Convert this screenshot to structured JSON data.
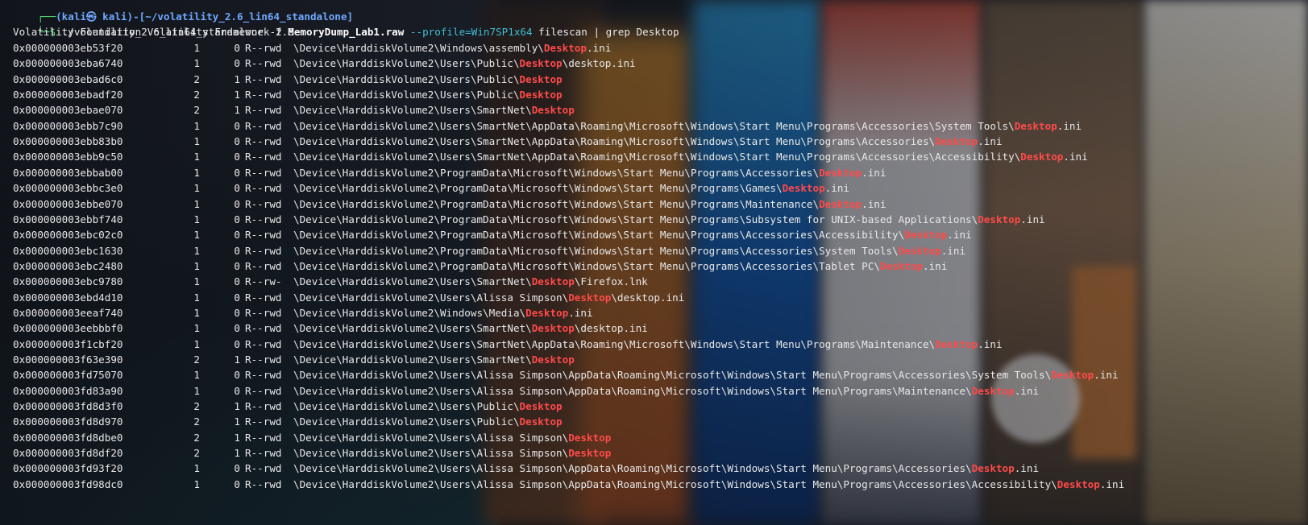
{
  "prompt": {
    "user_host": "(kali㉿ kali)-[~/volatility_2.6_lin64_standalone]",
    "cmd_program": "./volatility_2.6_lin64_standalone",
    "cmd_flag_f": "-f",
    "cmd_file": "MemoryDump_Lab1.raw",
    "cmd_profile": "--profile=Win7SP1x64",
    "cmd_plugin": "filescan",
    "cmd_pipe": "|",
    "cmd_grep": "grep Desktop"
  },
  "banner": "Volatility Foundation Volatility Framework 2.6",
  "highlight": "Desktop",
  "rows": [
    {
      "offset": "0x000000003eb53f20",
      "ptr": "1",
      "hnd": "0",
      "access": "R--rwd",
      "pre": "\\Device\\HarddiskVolume2\\Windows\\assembly\\",
      "post": ".ini"
    },
    {
      "offset": "0x000000003eba6740",
      "ptr": "1",
      "hnd": "0",
      "access": "R--rwd",
      "pre": "\\Device\\HarddiskVolume2\\Users\\Public\\",
      "post": "\\desktop.ini"
    },
    {
      "offset": "0x000000003ebad6c0",
      "ptr": "2",
      "hnd": "1",
      "access": "R--rwd",
      "pre": "\\Device\\HarddiskVolume2\\Users\\Public\\",
      "post": ""
    },
    {
      "offset": "0x000000003ebadf20",
      "ptr": "2",
      "hnd": "1",
      "access": "R--rwd",
      "pre": "\\Device\\HarddiskVolume2\\Users\\Public\\",
      "post": ""
    },
    {
      "offset": "0x000000003ebae070",
      "ptr": "2",
      "hnd": "1",
      "access": "R--rwd",
      "pre": "\\Device\\HarddiskVolume2\\Users\\SmartNet\\",
      "post": ""
    },
    {
      "offset": "0x000000003ebb7c90",
      "ptr": "1",
      "hnd": "0",
      "access": "R--rwd",
      "pre": "\\Device\\HarddiskVolume2\\Users\\SmartNet\\AppData\\Roaming\\Microsoft\\Windows\\Start Menu\\Programs\\Accessories\\System Tools\\",
      "post": ".ini"
    },
    {
      "offset": "0x000000003ebb83b0",
      "ptr": "1",
      "hnd": "0",
      "access": "R--rwd",
      "pre": "\\Device\\HarddiskVolume2\\Users\\SmartNet\\AppData\\Roaming\\Microsoft\\Windows\\Start Menu\\Programs\\Accessories\\",
      "post": ".ini"
    },
    {
      "offset": "0x000000003ebb9c50",
      "ptr": "1",
      "hnd": "0",
      "access": "R--rwd",
      "pre": "\\Device\\HarddiskVolume2\\Users\\SmartNet\\AppData\\Roaming\\Microsoft\\Windows\\Start Menu\\Programs\\Accessories\\Accessibility\\",
      "post": ".ini"
    },
    {
      "offset": "0x000000003ebbab00",
      "ptr": "1",
      "hnd": "0",
      "access": "R--rwd",
      "pre": "\\Device\\HarddiskVolume2\\ProgramData\\Microsoft\\Windows\\Start Menu\\Programs\\Accessories\\",
      "post": ".ini"
    },
    {
      "offset": "0x000000003ebbc3e0",
      "ptr": "1",
      "hnd": "0",
      "access": "R--rwd",
      "pre": "\\Device\\HarddiskVolume2\\ProgramData\\Microsoft\\Windows\\Start Menu\\Programs\\Games\\",
      "post": ".ini"
    },
    {
      "offset": "0x000000003ebbe070",
      "ptr": "1",
      "hnd": "0",
      "access": "R--rwd",
      "pre": "\\Device\\HarddiskVolume2\\ProgramData\\Microsoft\\Windows\\Start Menu\\Programs\\Maintenance\\",
      "post": ".ini"
    },
    {
      "offset": "0x000000003ebbf740",
      "ptr": "1",
      "hnd": "0",
      "access": "R--rwd",
      "pre": "\\Device\\HarddiskVolume2\\ProgramData\\Microsoft\\Windows\\Start Menu\\Programs\\Subsystem for UNIX-based Applications\\",
      "post": ".ini"
    },
    {
      "offset": "0x000000003ebc02c0",
      "ptr": "1",
      "hnd": "0",
      "access": "R--rwd",
      "pre": "\\Device\\HarddiskVolume2\\ProgramData\\Microsoft\\Windows\\Start Menu\\Programs\\Accessories\\Accessibility\\",
      "post": ".ini"
    },
    {
      "offset": "0x000000003ebc1630",
      "ptr": "1",
      "hnd": "0",
      "access": "R--rwd",
      "pre": "\\Device\\HarddiskVolume2\\ProgramData\\Microsoft\\Windows\\Start Menu\\Programs\\Accessories\\System Tools\\",
      "post": ".ini"
    },
    {
      "offset": "0x000000003ebc2480",
      "ptr": "1",
      "hnd": "0",
      "access": "R--rwd",
      "pre": "\\Device\\HarddiskVolume2\\ProgramData\\Microsoft\\Windows\\Start Menu\\Programs\\Accessories\\Tablet PC\\",
      "post": ".ini"
    },
    {
      "offset": "0x000000003ebc9780",
      "ptr": "1",
      "hnd": "0",
      "access": "R--rw-",
      "pre": "\\Device\\HarddiskVolume2\\Users\\SmartNet\\",
      "post": "\\Firefox.lnk"
    },
    {
      "offset": "0x000000003ebd4d10",
      "ptr": "1",
      "hnd": "0",
      "access": "R--rwd",
      "pre": "\\Device\\HarddiskVolume2\\Users\\Alissa Simpson\\",
      "post": "\\desktop.ini"
    },
    {
      "offset": "0x000000003eeaf740",
      "ptr": "1",
      "hnd": "0",
      "access": "R--rwd",
      "pre": "\\Device\\HarddiskVolume2\\Windows\\Media\\",
      "post": ".ini"
    },
    {
      "offset": "0x000000003eebbbf0",
      "ptr": "1",
      "hnd": "0",
      "access": "R--rwd",
      "pre": "\\Device\\HarddiskVolume2\\Users\\SmartNet\\",
      "post": "\\desktop.ini"
    },
    {
      "offset": "0x000000003f1cbf20",
      "ptr": "1",
      "hnd": "0",
      "access": "R--rwd",
      "pre": "\\Device\\HarddiskVolume2\\Users\\SmartNet\\AppData\\Roaming\\Microsoft\\Windows\\Start Menu\\Programs\\Maintenance\\",
      "post": ".ini"
    },
    {
      "offset": "0x000000003f63e390",
      "ptr": "2",
      "hnd": "1",
      "access": "R--rwd",
      "pre": "\\Device\\HarddiskVolume2\\Users\\SmartNet\\",
      "post": ""
    },
    {
      "offset": "0x000000003fd75070",
      "ptr": "1",
      "hnd": "0",
      "access": "R--rwd",
      "pre": "\\Device\\HarddiskVolume2\\Users\\Alissa Simpson\\AppData\\Roaming\\Microsoft\\Windows\\Start Menu\\Programs\\Accessories\\System Tools\\",
      "post": ".ini"
    },
    {
      "offset": "0x000000003fd83a90",
      "ptr": "1",
      "hnd": "0",
      "access": "R--rwd",
      "pre": "\\Device\\HarddiskVolume2\\Users\\Alissa Simpson\\AppData\\Roaming\\Microsoft\\Windows\\Start Menu\\Programs\\Maintenance\\",
      "post": ".ini"
    },
    {
      "offset": "0x000000003fd8d3f0",
      "ptr": "2",
      "hnd": "1",
      "access": "R--rwd",
      "pre": "\\Device\\HarddiskVolume2\\Users\\Public\\",
      "post": ""
    },
    {
      "offset": "0x000000003fd8d970",
      "ptr": "2",
      "hnd": "1",
      "access": "R--rwd",
      "pre": "\\Device\\HarddiskVolume2\\Users\\Public\\",
      "post": ""
    },
    {
      "offset": "0x000000003fd8dbe0",
      "ptr": "2",
      "hnd": "1",
      "access": "R--rwd",
      "pre": "\\Device\\HarddiskVolume2\\Users\\Alissa Simpson\\",
      "post": ""
    },
    {
      "offset": "0x000000003fd8df20",
      "ptr": "2",
      "hnd": "1",
      "access": "R--rwd",
      "pre": "\\Device\\HarddiskVolume2\\Users\\Alissa Simpson\\",
      "post": ""
    },
    {
      "offset": "0x000000003fd93f20",
      "ptr": "1",
      "hnd": "0",
      "access": "R--rwd",
      "pre": "\\Device\\HarddiskVolume2\\Users\\Alissa Simpson\\AppData\\Roaming\\Microsoft\\Windows\\Start Menu\\Programs\\Accessories\\",
      "post": ".ini"
    },
    {
      "offset": "0x000000003fd98dc0",
      "ptr": "1",
      "hnd": "0",
      "access": "R--rwd",
      "pre": "\\Device\\HarddiskVolume2\\Users\\Alissa Simpson\\AppData\\Roaming\\Microsoft\\Windows\\Start Menu\\Programs\\Accessories\\Accessibility\\",
      "post": ".ini"
    }
  ],
  "colors": {
    "prompt_green": "#4fd36b",
    "prompt_blue": "#6ea8ff",
    "highlight_red": "#ff4a4a",
    "text": "#e8e8e8"
  }
}
